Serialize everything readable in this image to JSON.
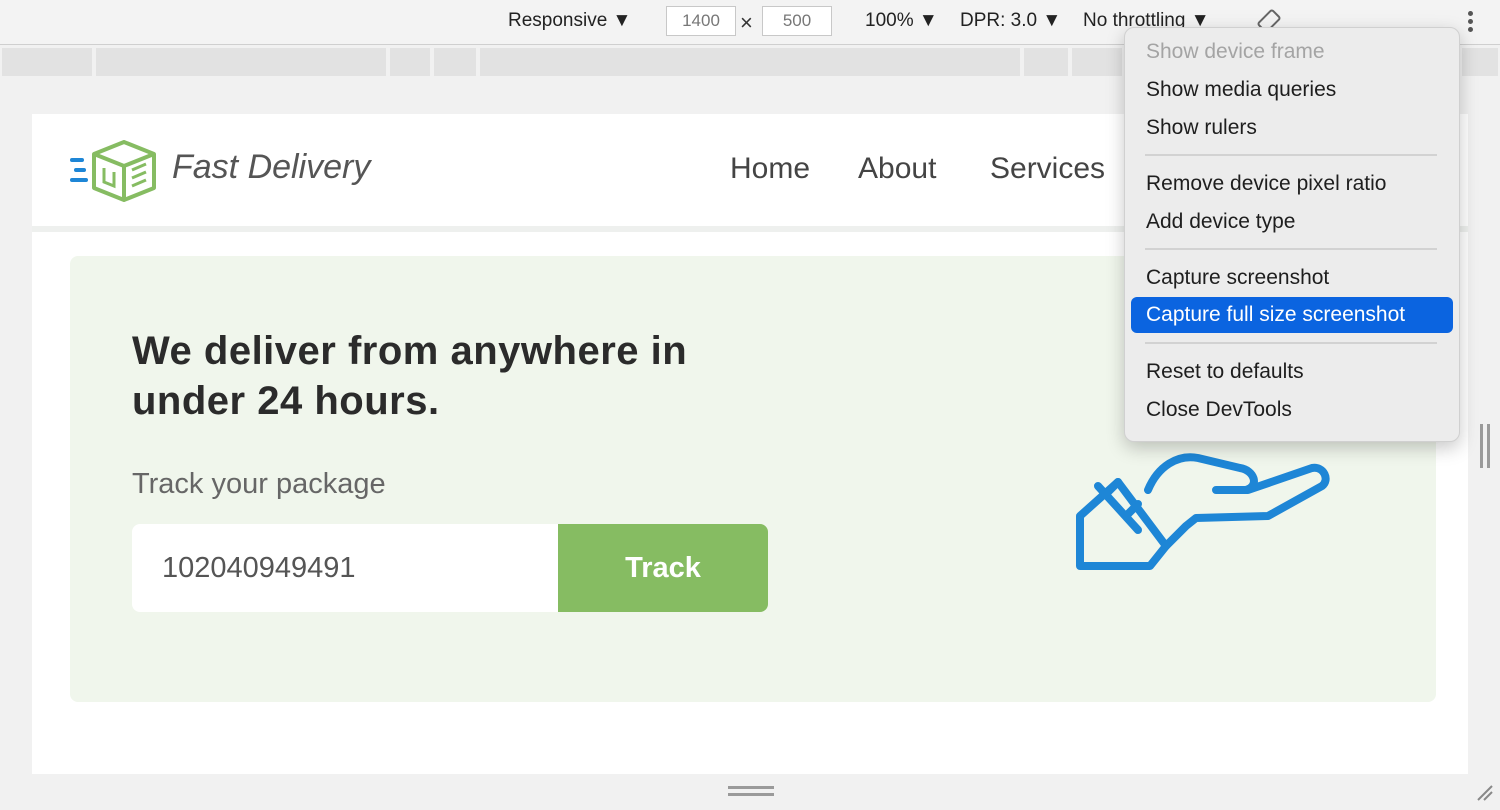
{
  "toolbar": {
    "device": "Responsive ▼",
    "width": "1400",
    "height": "500",
    "times": "×",
    "zoom": "100% ▼",
    "dpr": "DPR: 3.0 ▼",
    "throttling": "No throttling ▼"
  },
  "site": {
    "brand": "Fast Delivery",
    "nav": [
      "Home",
      "About",
      "Services"
    ],
    "hero_title": "We deliver from anywhere in under 24 hours.",
    "track_label": "Track your package",
    "track_value": "102040949491",
    "track_button": "Track"
  },
  "menu": {
    "items": [
      "Show device frame",
      "Show media queries",
      "Show rulers",
      "Remove device pixel ratio",
      "Add device type",
      "Capture screenshot",
      "Capture full size screenshot",
      "Reset to defaults",
      "Close DevTools"
    ],
    "disabled_item": "Show device frame",
    "highlighted_item": "Capture full size screenshot"
  },
  "colors": {
    "brand_green": "#86bc62",
    "hero_bg": "#f0f6ec",
    "menu_highlight": "#0b64e0",
    "illustration_blue": "#1e86d6"
  }
}
